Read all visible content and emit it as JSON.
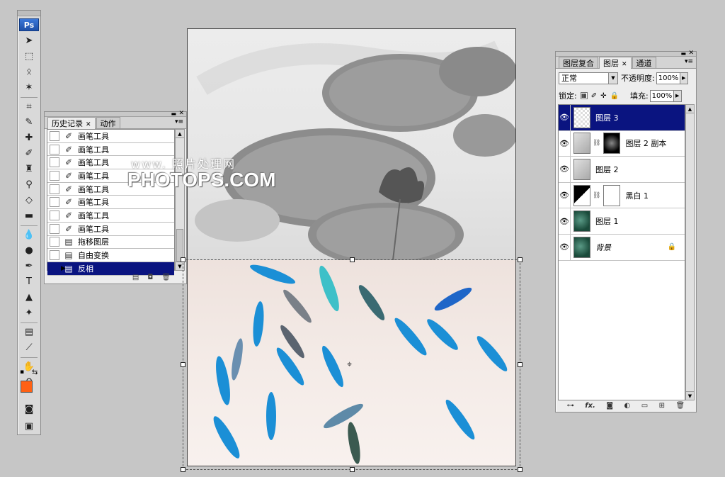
{
  "toolbox": {
    "logo": "Ps",
    "tools": [
      {
        "name": "move-tool-icon",
        "glyph": "➤"
      },
      {
        "name": "marquee-tool-icon",
        "glyph": "⬚"
      },
      {
        "name": "lasso-tool-icon",
        "glyph": "ᛟ"
      },
      {
        "name": "magic-wand-tool-icon",
        "glyph": "✶"
      },
      {
        "name": "crop-tool-icon",
        "glyph": "⌗"
      },
      {
        "name": "slice-tool-icon",
        "glyph": "✎"
      },
      {
        "name": "healing-brush-tool-icon",
        "glyph": "✚"
      },
      {
        "name": "brush-tool-icon",
        "glyph": "✐"
      },
      {
        "name": "clone-stamp-tool-icon",
        "glyph": "♜"
      },
      {
        "name": "history-brush-tool-icon",
        "glyph": "⚲"
      },
      {
        "name": "eraser-tool-icon",
        "glyph": "◇"
      },
      {
        "name": "gradient-tool-icon",
        "glyph": "▬"
      },
      {
        "name": "blur-tool-icon",
        "glyph": "💧"
      },
      {
        "name": "dodge-tool-icon",
        "glyph": "●"
      },
      {
        "name": "pen-tool-icon",
        "glyph": "✒"
      },
      {
        "name": "type-tool-icon",
        "glyph": "T"
      },
      {
        "name": "path-selection-tool-icon",
        "glyph": "▲"
      },
      {
        "name": "custom-shape-tool-icon",
        "glyph": "✦"
      },
      {
        "name": "notes-tool-icon",
        "glyph": "▤"
      },
      {
        "name": "eyedropper-tool-icon",
        "glyph": "⟋"
      },
      {
        "name": "hand-tool-icon",
        "glyph": "✋"
      },
      {
        "name": "zoom-tool-icon",
        "glyph": "⚲"
      }
    ],
    "foreground_color": "#ff6114",
    "background_color": "#ffffff"
  },
  "history_panel": {
    "tabs": [
      {
        "label": "历史记录",
        "close": "✕"
      },
      {
        "label": "动作"
      }
    ],
    "items": [
      {
        "label": "画笔工具",
        "icon": "brush-icon"
      },
      {
        "label": "画笔工具",
        "icon": "brush-icon"
      },
      {
        "label": "画笔工具",
        "icon": "brush-icon"
      },
      {
        "label": "画笔工具",
        "icon": "brush-icon"
      },
      {
        "label": "画笔工具",
        "icon": "brush-icon"
      },
      {
        "label": "画笔工具",
        "icon": "brush-icon"
      },
      {
        "label": "画笔工具",
        "icon": "brush-icon"
      },
      {
        "label": "画笔工具",
        "icon": "brush-icon"
      },
      {
        "label": "拖移图层",
        "icon": "document-icon"
      },
      {
        "label": "自由变换",
        "icon": "document-icon"
      },
      {
        "label": "反相",
        "icon": "document-icon",
        "selected": true
      }
    ]
  },
  "canvas": {
    "watermark_url": "www.",
    "watermark_site": "照片处理网",
    "watermark_brand": "PHOTOPS.COM"
  },
  "layers_panel": {
    "tabs": [
      {
        "label": "图层复合"
      },
      {
        "label": "图层",
        "close": "✕"
      },
      {
        "label": "通道"
      }
    ],
    "blend_mode": "正常",
    "opacity_label": "不透明度:",
    "opacity_value": "100%",
    "lock_label": "锁定:",
    "fill_label": "填充:",
    "fill_value": "100%",
    "layers": [
      {
        "name": "图层 3",
        "thumb": "checker",
        "selected": true
      },
      {
        "name": "图层 2 副本",
        "thumb": "gray",
        "mask": true
      },
      {
        "name": "图层 2",
        "thumb": "gray"
      },
      {
        "name": "黑白 1",
        "thumb": "adj",
        "mask": true,
        "mask_white": true
      },
      {
        "name": "图层 1",
        "thumb": "fish"
      },
      {
        "name": "背景",
        "thumb": "fish",
        "locked": true,
        "italic": true
      }
    ]
  }
}
